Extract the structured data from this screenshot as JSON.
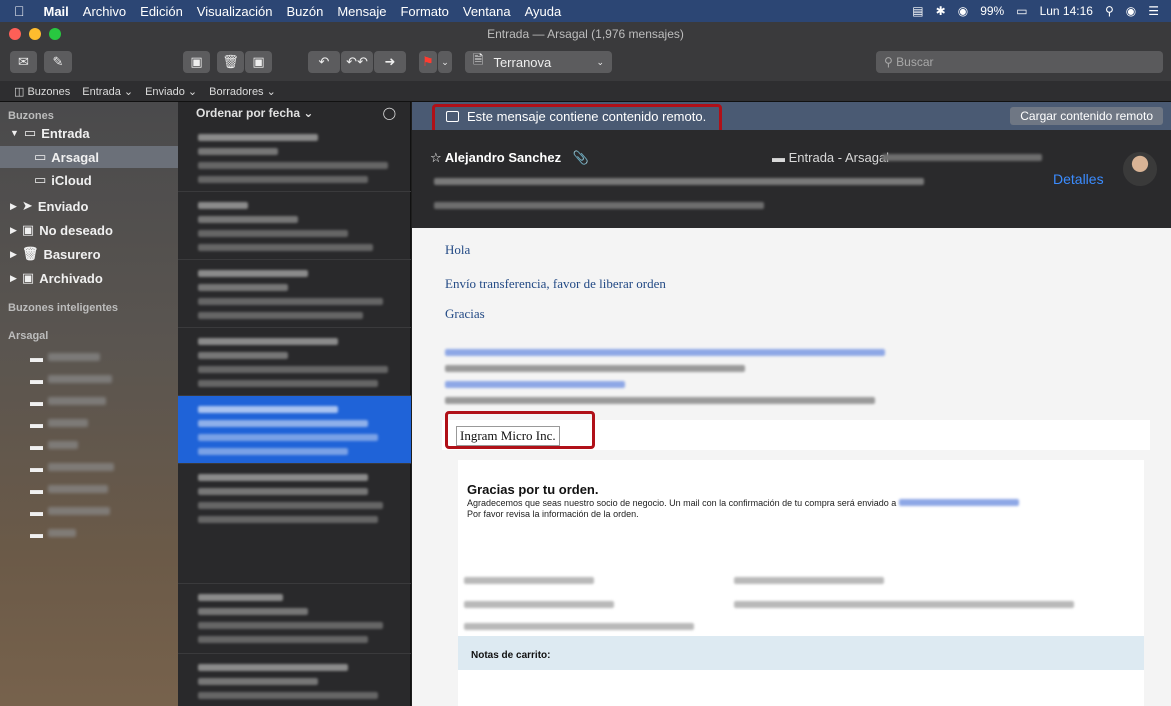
{
  "menubar": {
    "app_name": "Mail",
    "items": [
      "Archivo",
      "Edición",
      "Visualización",
      "Buzón",
      "Mensaje",
      "Formato",
      "Ventana",
      "Ayuda"
    ],
    "battery": "99%",
    "clock": "Lun 14:16"
  },
  "window": {
    "title": "Entrada — Arsagal (1,976 mensajes)"
  },
  "toolbar": {
    "mailbox_selector": "Terranova",
    "search_placeholder": "Buscar"
  },
  "favorites": [
    "Buzones",
    "Entrada",
    "Enviado",
    "Borradores"
  ],
  "sidebar": {
    "section_buzones": "Buzones",
    "inbox": "Entrada",
    "inbox_children": [
      "Arsagal",
      "iCloud"
    ],
    "others": [
      "Enviado",
      "No deseado",
      "Basurero",
      "Archivado"
    ],
    "section_smart": "Buzones inteligentes",
    "section_account": "Arsagal"
  },
  "message_list": {
    "sort_label": "Ordenar por fecha"
  },
  "viewer": {
    "remote_banner": "Este mensaje contiene contenido remoto.",
    "load_remote_button": "Cargar contenido remoto",
    "sender": "Alejandro Sanchez",
    "mailbox": "Entrada - Arsagal",
    "details_link": "Detalles",
    "body_lines": [
      "Hola",
      "Envío transferencia, favor de liberar orden",
      "Gracias"
    ],
    "company": "Ingram Micro Inc.",
    "card_title": "Gracias por tu orden.",
    "card_line1": "Agradecemos que seas nuestro socio de negocio. Un mail con la confirmación de tu compra será enviado a",
    "card_line2": "Por favor revisa la información de la orden.",
    "notes_label": "Notas de carrito:"
  },
  "colors": {
    "accent": "#1f63d8",
    "highlight_box": "#b01018",
    "banner": "#4a5a73"
  }
}
